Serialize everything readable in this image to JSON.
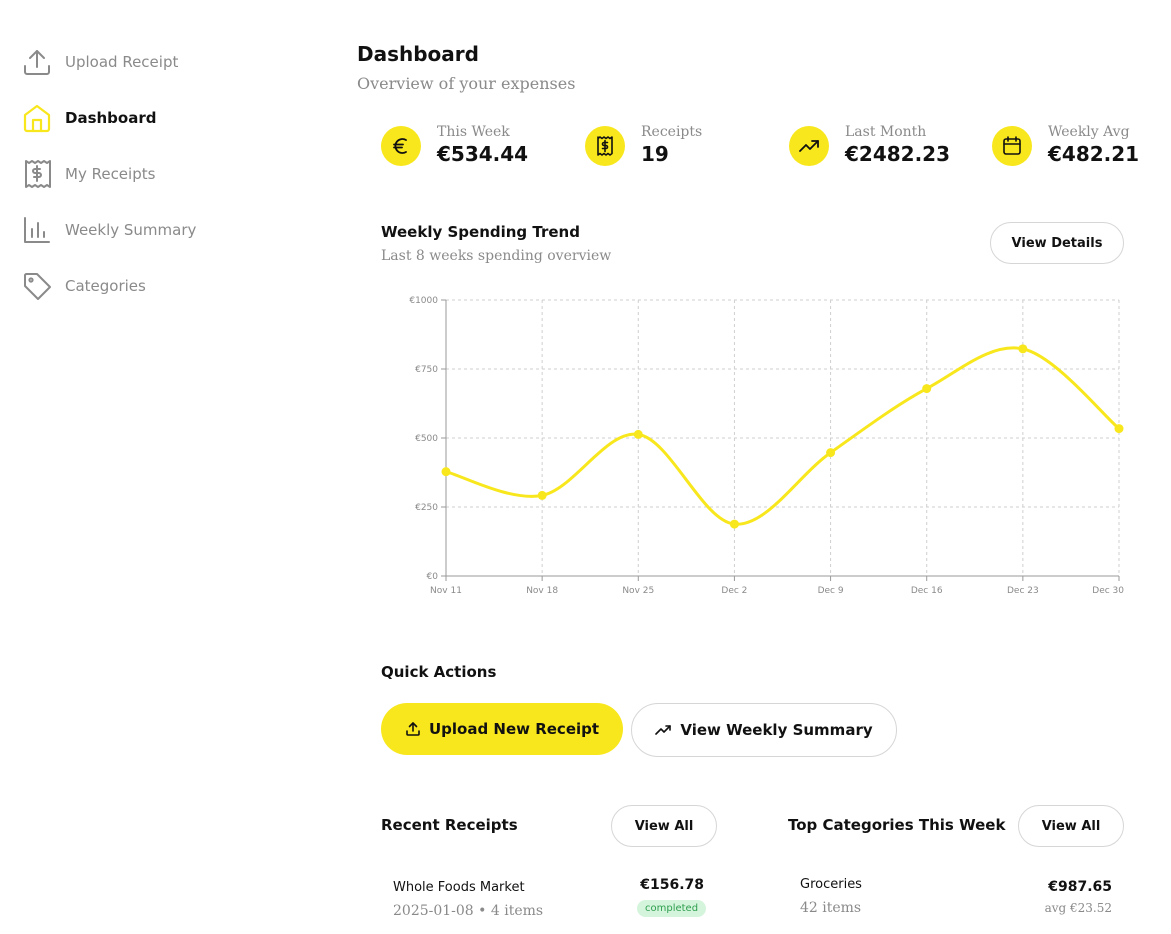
{
  "sidebar": {
    "items": [
      {
        "label": "Upload Receipt",
        "icon": "upload-icon",
        "active": false
      },
      {
        "label": "Dashboard",
        "icon": "home-icon",
        "active": true
      },
      {
        "label": "My Receipts",
        "icon": "receipt-icon",
        "active": false
      },
      {
        "label": "Weekly Summary",
        "icon": "bar-chart-icon",
        "active": false
      },
      {
        "label": "Categories",
        "icon": "tag-icon",
        "active": false
      }
    ]
  },
  "header": {
    "title": "Dashboard",
    "subtitle": "Overview of your expenses"
  },
  "stats": [
    {
      "label": "This Week",
      "value": "€534.44",
      "icon": "euro-icon"
    },
    {
      "label": "Receipts",
      "value": "19",
      "icon": "receipt-dollar-icon"
    },
    {
      "label": "Last Month",
      "value": "€2482.23",
      "icon": "trending-up-icon"
    },
    {
      "label": "Weekly Avg",
      "value": "€482.21",
      "icon": "calendar-icon"
    }
  ],
  "trend": {
    "title": "Weekly Spending Trend",
    "subtitle": "Last 8 weeks spending overview",
    "details_label": "View Details"
  },
  "chart_data": {
    "type": "line",
    "categories": [
      "Nov 11",
      "Nov 18",
      "Nov 25",
      "Dec 2",
      "Dec 9",
      "Dec 16",
      "Dec 23",
      "Dec 30"
    ],
    "values": [
      378,
      292,
      513,
      188,
      447,
      679,
      823,
      534
    ],
    "y_ticks": [
      "€0",
      "€250",
      "€500",
      "€750",
      "€1000"
    ],
    "ylim": [
      0,
      1000
    ],
    "grid": true,
    "color": "#f8e71c"
  },
  "quick_actions": {
    "title": "Quick Actions",
    "upload_label": "Upload New Receipt",
    "summary_label": "View Weekly Summary"
  },
  "recent": {
    "title": "Recent Receipts",
    "view_all": "View All",
    "items": [
      {
        "name": "Whole Foods Market",
        "meta": "2025-01-08 • 4 items",
        "amount": "€156.78",
        "status": "completed"
      }
    ]
  },
  "top_categories": {
    "title": "Top Categories This Week",
    "view_all": "View All",
    "items": [
      {
        "name": "Groceries",
        "meta": "42 items",
        "amount": "€987.65",
        "avg": "avg €23.52"
      }
    ]
  }
}
